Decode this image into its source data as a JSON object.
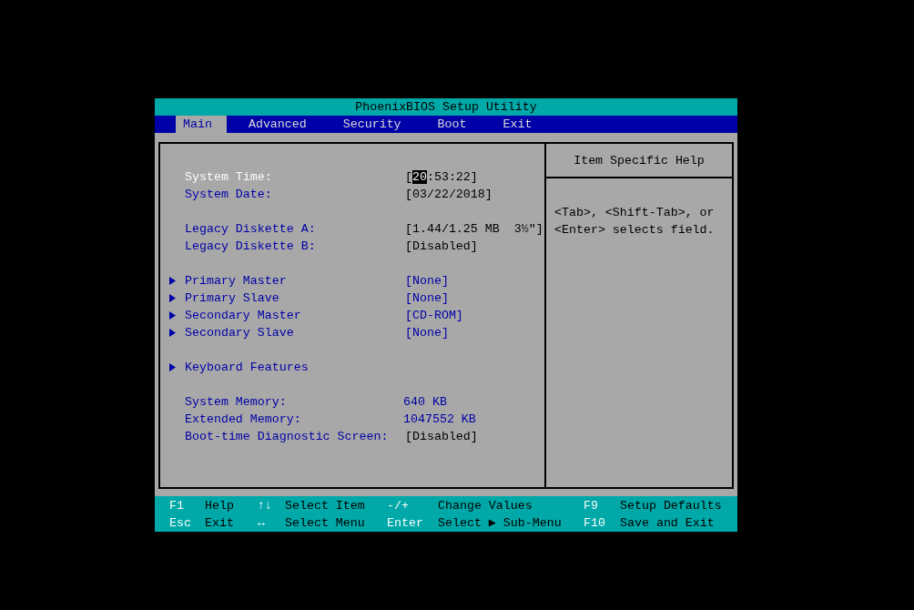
{
  "window": {
    "title": "PhoenixBIOS Setup Utility"
  },
  "tabs": [
    {
      "label": "Main",
      "selected": true
    },
    {
      "label": "Advanced",
      "selected": false
    },
    {
      "label": "Security",
      "selected": false
    },
    {
      "label": "Boot",
      "selected": false
    },
    {
      "label": "Exit",
      "selected": false
    }
  ],
  "groups": [
    {
      "items": [
        {
          "kind": "field",
          "label": "System Time:",
          "selected": true,
          "value": [
            {
              "text": "[",
              "highlighted": false
            },
            {
              "text": "20",
              "highlighted": true
            },
            {
              "text": ":53:22]",
              "highlighted": false
            }
          ]
        },
        {
          "kind": "field",
          "label": "System Date:",
          "selected": false,
          "value": [
            {
              "text": "[03/22/2018]",
              "highlighted": false
            }
          ]
        }
      ]
    },
    {
      "items": [
        {
          "kind": "field",
          "label": "Legacy Diskette A:",
          "selected": false,
          "value": [
            {
              "text": "[1.44/1.25 MB  3½\"]",
              "highlighted": false
            }
          ]
        },
        {
          "kind": "field",
          "label": "Legacy Diskette B:",
          "selected": false,
          "value": [
            {
              "text": "[Disabled]",
              "highlighted": false
            }
          ]
        }
      ]
    },
    {
      "items": [
        {
          "kind": "submenu",
          "label": "Primary Master",
          "selected": false,
          "value": [
            {
              "text": "[None]",
              "highlighted": false
            }
          ]
        },
        {
          "kind": "submenu",
          "label": "Primary Slave",
          "selected": false,
          "value": [
            {
              "text": "[None]",
              "highlighted": false
            }
          ]
        },
        {
          "kind": "submenu",
          "label": "Secondary Master",
          "selected": false,
          "value": [
            {
              "text": "[CD-ROM]",
              "highlighted": false
            }
          ]
        },
        {
          "kind": "submenu",
          "label": "Secondary Slave",
          "selected": false,
          "value": [
            {
              "text": "[None]",
              "highlighted": false
            }
          ]
        }
      ]
    },
    {
      "items": [
        {
          "kind": "submenu",
          "label": "Keyboard Features",
          "selected": false
        }
      ]
    },
    {
      "items": [
        {
          "kind": "info",
          "label": "System Memory:",
          "selected": false,
          "value": [
            {
              "text": "640 KB",
              "highlighted": false
            }
          ]
        },
        {
          "kind": "info",
          "label": "Extended Memory:",
          "selected": false,
          "value": [
            {
              "text": "1047552 KB",
              "highlighted": false
            }
          ]
        },
        {
          "kind": "field",
          "label": "Boot-time Diagnostic Screen:",
          "selected": false,
          "value": [
            {
              "text": "[Disabled]",
              "highlighted": false
            }
          ]
        }
      ]
    }
  ],
  "help": {
    "heading": "Item Specific Help",
    "text": "<Tab>, <Shift-Tab>, or <Enter> selects field."
  },
  "key_legend": [
    [
      {
        "key": "F1",
        "action": "Help"
      },
      {
        "key": "↑↓",
        "action": "Select Item"
      },
      {
        "key": "-/+",
        "action": "Change Values"
      },
      {
        "key": "F9",
        "action": "Setup Defaults"
      }
    ],
    [
      {
        "key": "Esc",
        "action": "Exit"
      },
      {
        "key": "↔",
        "action": "Select Menu"
      },
      {
        "key": "Enter",
        "action": "Select ▶ Sub-Menu"
      },
      {
        "key": "F10",
        "action": "Save and Exit"
      }
    ]
  ]
}
